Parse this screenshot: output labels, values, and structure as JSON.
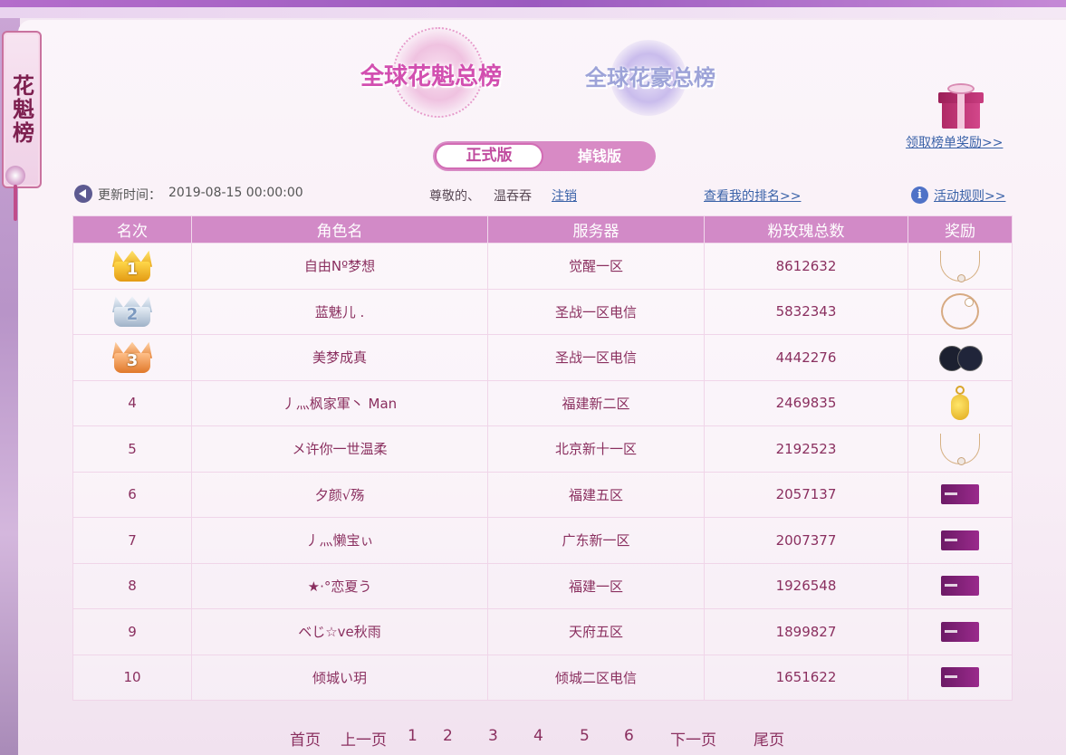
{
  "side_tag": "花魁榜",
  "tabs": [
    {
      "label": "全球花魁总榜",
      "active": true
    },
    {
      "label": "全球花豪总榜",
      "active": false
    }
  ],
  "version_toggle": {
    "active": "正式版",
    "inactive": "掉钱版"
  },
  "reward_link": "领取榜单奖励>>",
  "update": {
    "label": "更新时间：",
    "time": "2019-08-15 00:00:00"
  },
  "user": {
    "greeting": "尊敬的、",
    "name": "温吞吞",
    "logout": "注销"
  },
  "my_rank_link": "查看我的排名>>",
  "rules_link": "活动规则>>",
  "table": {
    "headers": [
      "名次",
      "角色名",
      "服务器",
      "粉玫瑰总数",
      "奖励"
    ],
    "rows": [
      {
        "rank": "1",
        "name": "自由Nº梦想",
        "server": "觉醒一区",
        "roses": "8612632",
        "prize": "necklace-icon"
      },
      {
        "rank": "2",
        "name": "蓝魅儿 .",
        "server": "圣战一区电信",
        "roses": "5832343",
        "prize": "bracelet-icon"
      },
      {
        "rank": "3",
        "name": "美梦成真",
        "server": "圣战一区电信",
        "roses": "4442276",
        "prize": "compact-icon"
      },
      {
        "rank": "4",
        "name": "丿灬枫家軍丶 Man",
        "server": "福建新二区",
        "roses": "2469835",
        "prize": "gold-pendant-icon"
      },
      {
        "rank": "5",
        "name": "メ许你一世温柔",
        "server": "北京新十一区",
        "roses": "2192523",
        "prize": "necklace-icon"
      },
      {
        "rank": "6",
        "name": "夕颜√殇",
        "server": "福建五区",
        "roses": "2057137",
        "prize": "gift-card-icon"
      },
      {
        "rank": "7",
        "name": "丿灬懒宝ぃ",
        "server": "广东新一区",
        "roses": "2007377",
        "prize": "gift-card-icon"
      },
      {
        "rank": "8",
        "name": "★·°恋夏う",
        "server": "福建一区",
        "roses": "1926548",
        "prize": "gift-card-icon"
      },
      {
        "rank": "9",
        "name": "ベじ☆ve秋雨",
        "server": "天府五区",
        "roses": "1899827",
        "prize": "gift-card-icon"
      },
      {
        "rank": "10",
        "name": "倾城い玥",
        "server": "倾城二区电信",
        "roses": "1651622",
        "prize": "gift-card-icon"
      }
    ]
  },
  "pager": {
    "first": "首页",
    "prev": "上一页",
    "pages": [
      "1",
      "2",
      "3",
      "4",
      "5",
      "6"
    ],
    "next": "下一页",
    "last": "尾页"
  },
  "colors": {
    "header_bg": "#d28ac7",
    "text": "#8a2f5f",
    "link": "#3a62a8",
    "accent": "#d24fb0"
  }
}
